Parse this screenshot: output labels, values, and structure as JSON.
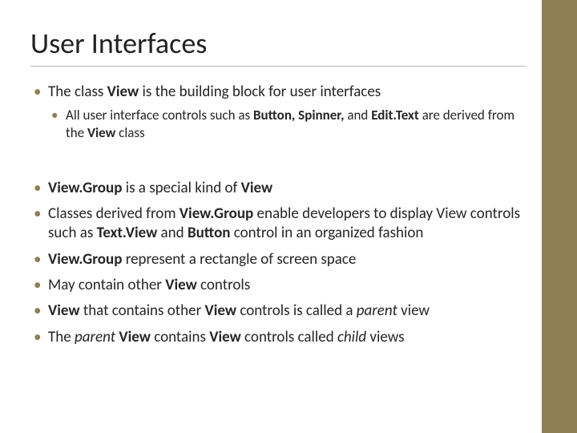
{
  "title": "User Interfaces",
  "group1": {
    "b1_pre": "The class ",
    "b1_bold": "View",
    "b1_post": " is the building block for user interfaces",
    "sub_pre": "All user interface controls such as ",
    "sub_b1": "Button, Spinner,",
    "sub_mid": " and ",
    "sub_b2": "Edit.Text",
    "sub_post1": " are derived from the ",
    "sub_b3": "View",
    "sub_post2": " class"
  },
  "group2": {
    "b2_b1": "View.Group",
    "b2_mid": " is a special kind of ",
    "b2_b2": "View",
    "b3_pre": "Classes derived from ",
    "b3_b1": "View.Group",
    "b3_mid1": " enable developers to display View controls such as ",
    "b3_b2": "Text.View",
    "b3_mid2": " and ",
    "b3_b3": "Button",
    "b3_post": " control in an organized fashion",
    "b4_b1": "View.Group ",
    "b4_post": "represent a rectangle of screen space",
    "b5_pre": "May contain other ",
    "b5_b1": "View",
    "b5_post": " controls",
    "b6_b1": "View ",
    "b6_mid1": "that contains other ",
    "b6_b2": "View",
    "b6_mid2": " controls is called a ",
    "b6_i": "parent",
    "b6_post": " view",
    "b7_pre": "The ",
    "b7_i1": "parent",
    "b7_mid1": " ",
    "b7_b1": "View",
    "b7_mid2": " contains ",
    "b7_b2": "View",
    "b7_mid3": " controls called ",
    "b7_i2": "child",
    "b7_post": " views"
  }
}
